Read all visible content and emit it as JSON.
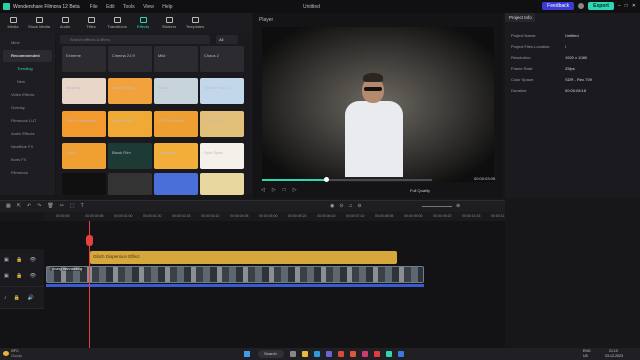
{
  "window": {
    "title": "Wondershare Filmora 12 Beta",
    "doc_title": "Untitled",
    "menu": [
      "File",
      "Edit",
      "Tools",
      "View",
      "Help"
    ],
    "feedback": "Feedback",
    "export": "Export"
  },
  "colors": {
    "accent": "#2fd6b4",
    "playhead": "#e7413e",
    "effect_clip": "#d6a73c",
    "export_btn": "#2fd6b4",
    "feedback_btn": "#3b3bd6"
  },
  "tooltabs": [
    {
      "label": "Media",
      "icon": "media-icon"
    },
    {
      "label": "Stock Media",
      "icon": "stock-media-icon"
    },
    {
      "label": "Audio",
      "icon": "audio-icon"
    },
    {
      "label": "Titles",
      "icon": "titles-icon"
    },
    {
      "label": "Transitions",
      "icon": "transitions-icon"
    },
    {
      "label": "Effects",
      "icon": "effects-icon",
      "active": true
    },
    {
      "label": "Stickers",
      "icon": "stickers-icon"
    },
    {
      "label": "Templates",
      "icon": "templates-icon"
    }
  ],
  "categories": [
    "Mine",
    "Recommended",
    "Trending",
    "New",
    "Video Effects",
    "Overlay",
    "Filmstock LUT",
    "Audio Effects",
    "NewBlue FX",
    "Boris FX",
    "Filmstock"
  ],
  "effects": {
    "search_placeholder": "Search effects & filters",
    "filter": "All",
    "tiles": [
      {
        "label": "Extreme",
        "bg": "#2b2b30"
      },
      {
        "label": "Cinema 21:9",
        "bg": "#2b2b30"
      },
      {
        "label": "Mild",
        "bg": "#2b2b30"
      },
      {
        "label": "Chaos 2",
        "bg": "#2b2b30"
      },
      {
        "label": "Beautify",
        "bg": "#e8d6c8"
      },
      {
        "label": "Neon Swing",
        "bg": "#f2a23c"
      },
      {
        "label": "Willow",
        "bg": "#c7d4dc"
      },
      {
        "label": "Twinkle Star 1",
        "bg": "#c2d8ea"
      },
      {
        "label": "Glitch Dispersion",
        "bg": "#f39a2e"
      },
      {
        "label": "Square Blur",
        "bg": "#f1a935"
      },
      {
        "label": "VCR Distortion",
        "bg": "#ef9e31"
      },
      {
        "label": "Up Down 1",
        "bg": "#e2c07a"
      },
      {
        "label": "Scale",
        "bg": "#f0a030"
      },
      {
        "label": "Blank Film",
        "bg": "#1d3a35"
      },
      {
        "label": "Heartbeat",
        "bg": "#f3ae3a"
      },
      {
        "label": "Spin Open",
        "bg": "#f4f1ea"
      },
      {
        "label": "",
        "bg": "#101010"
      },
      {
        "label": "",
        "bg": "#333"
      },
      {
        "label": "",
        "bg": "#4a6fd8"
      },
      {
        "label": "",
        "bg": "#e9d7a0"
      }
    ]
  },
  "player": {
    "title": "Player",
    "time": "00:00:03:05",
    "quality": "Full Quality"
  },
  "project": {
    "header": "Project Info",
    "rows": [
      {
        "k": "Project Name:",
        "v": "Untitled"
      },
      {
        "k": "Project Files Location:",
        "v": "/"
      },
      {
        "k": "Resolution:",
        "v": "1920 x 1080"
      },
      {
        "k": "Frame Rate:",
        "v": "25fps"
      },
      {
        "k": "Color Space:",
        "v": "SDR - Rec.709"
      },
      {
        "k": "Duration:",
        "v": "00:00:08:18"
      }
    ]
  },
  "ruler": [
    "00:00:00",
    "00:00:00:05",
    "00:00:01:00",
    "00:00:01:20",
    "00:00:02:15",
    "00:00:03:10",
    "00:00:04:05",
    "00:00:05:00",
    "00:00:05:20",
    "00:00:06:15",
    "00:00:07:10",
    "00:00:08:05",
    "00:00:09:00",
    "00:00:09:20",
    "00:00:10:15",
    "00:00:11:10"
  ],
  "timeline": {
    "effect_clip_label": "Glitch Dispersion Effect",
    "video_clip_label": "young-man-walking"
  },
  "taskbar": {
    "weather_temp": "29°C",
    "weather_desc": "Cloudy",
    "search": "Search",
    "lang": "ENG",
    "region": "US",
    "time": "21:13",
    "date": "03-12-2023"
  }
}
